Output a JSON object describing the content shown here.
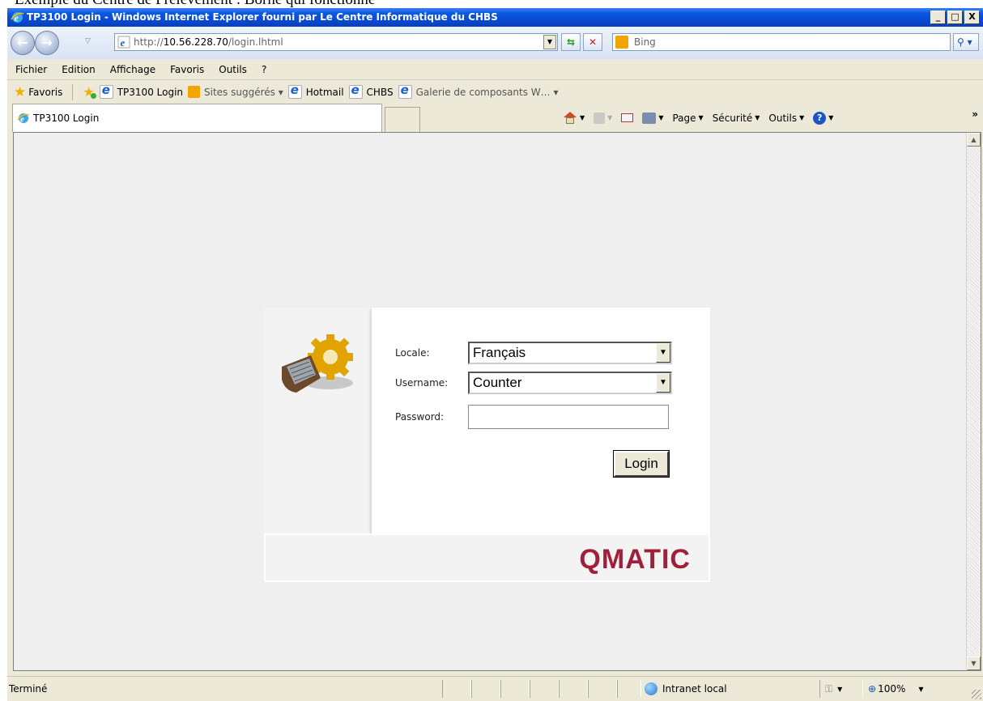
{
  "document_caption": "Exemple du Centre de Prélèvement : Borne qui fonctionne",
  "window": {
    "title": "TP3100 Login - Windows Internet Explorer fourni par Le Centre Informatique du CHBS",
    "controls": {
      "minimize": "_",
      "maximize": "□",
      "close": "X"
    }
  },
  "address": {
    "url_prefix": "http://",
    "url_host": "10.56.228.70",
    "url_path": "/login.lhtml",
    "search_placeholder": "Bing"
  },
  "menu": [
    "Fichier",
    "Edition",
    "Affichage",
    "Favoris",
    "Outils",
    "?"
  ],
  "favorites_bar": {
    "favorites_label": "Favoris",
    "links": [
      "TP3100 Login",
      "Sites suggérés ▾",
      "Hotmail",
      "CHBS",
      "Galerie de composants W… ▾"
    ]
  },
  "tab": {
    "label": "TP3100 Login"
  },
  "command_bar": {
    "page": "Page",
    "security": "Sécurité",
    "tools": "Outils"
  },
  "login_form": {
    "locale_label": "Locale:",
    "locale_value": "Français",
    "username_label": "Username:",
    "username_value": "Counter",
    "password_label": "Password:",
    "password_value": "",
    "login_button": "Login",
    "brand": "QMATIC"
  },
  "status_bar": {
    "status": "Terminé",
    "zone": "Intranet local",
    "zoom": "100%"
  },
  "colors": {
    "brand": "#a0203a",
    "titlebar": "#0a56e0"
  }
}
